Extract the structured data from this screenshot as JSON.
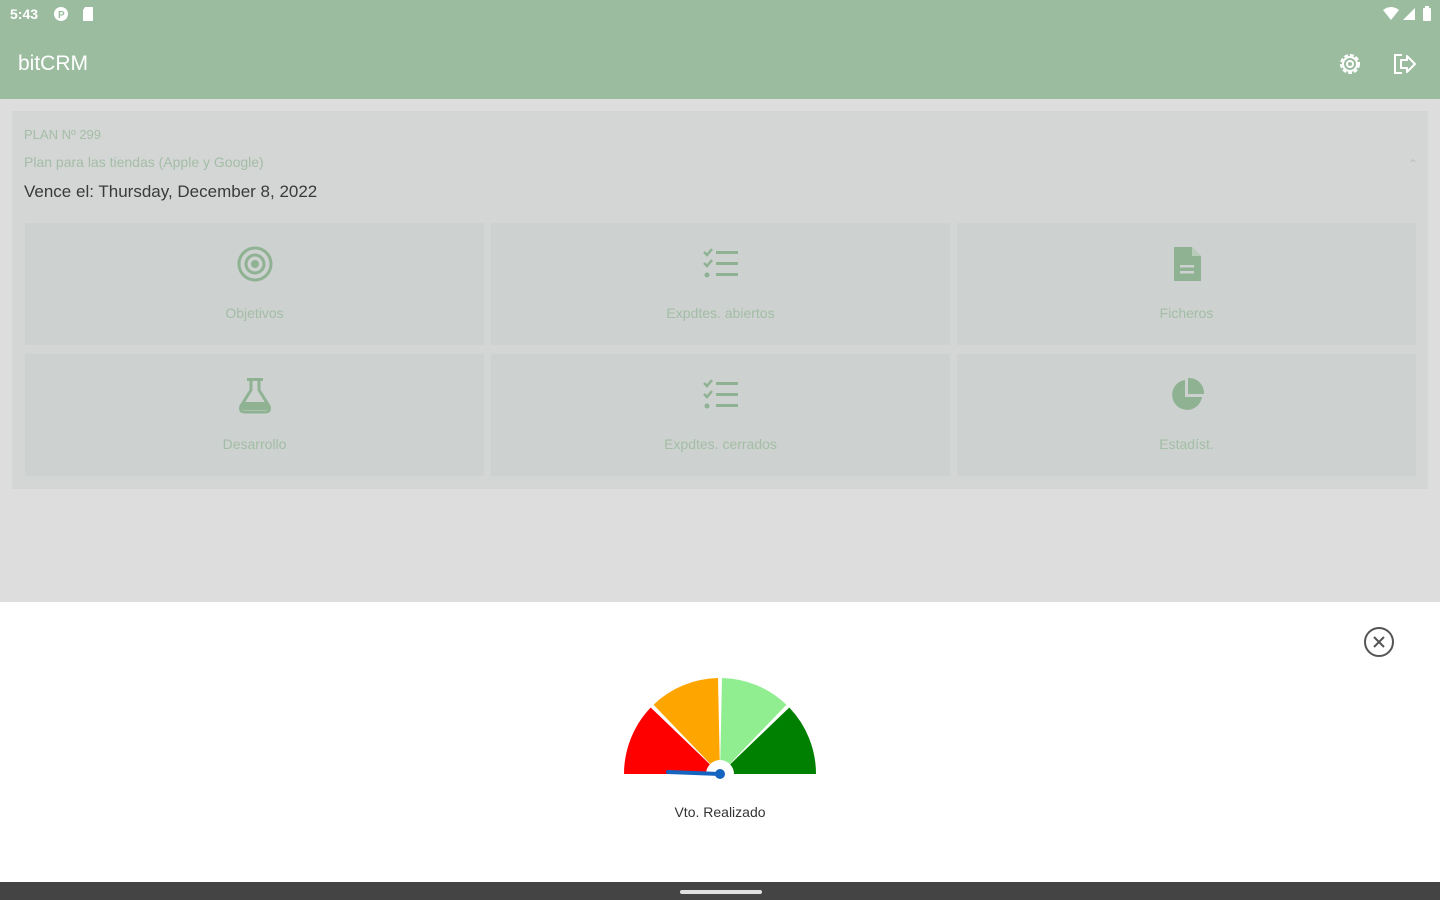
{
  "status_bar": {
    "time": "5:43",
    "icons": [
      "sync-icon",
      "sd-card-icon",
      "wifi-icon",
      "signal-icon",
      "battery-icon"
    ]
  },
  "app_bar": {
    "title": "bitCRM",
    "actions": [
      "settings-icon",
      "logout-icon"
    ]
  },
  "plan": {
    "number": "PLAN Nº 299",
    "description": "Plan para las tiendas (Apple y Google)",
    "expiry": "Vence el: Thursday, December 8, 2022"
  },
  "tiles": [
    {
      "label": "Objetivos",
      "icon": "target-icon"
    },
    {
      "label": "Expdtes. abiertos",
      "icon": "checklist-icon"
    },
    {
      "label": "Ficheros",
      "icon": "document-icon"
    },
    {
      "label": "Desarrollo",
      "icon": "flask-icon"
    },
    {
      "label": "Expdtes. cerrados",
      "icon": "checklist-icon"
    },
    {
      "label": "Estadíst.",
      "icon": "pie-chart-icon"
    }
  ],
  "gauge": {
    "label": "Vto. Realizado",
    "value_fraction": 0.0,
    "zone_colors": [
      "#ff0000",
      "#ffa500",
      "#90ee90",
      "#008000"
    ],
    "needle_color": "#1565c0"
  },
  "colors": {
    "primary": "#9cbca0",
    "accent_text": "#a3bda6",
    "icon_green": "#8fb293"
  }
}
